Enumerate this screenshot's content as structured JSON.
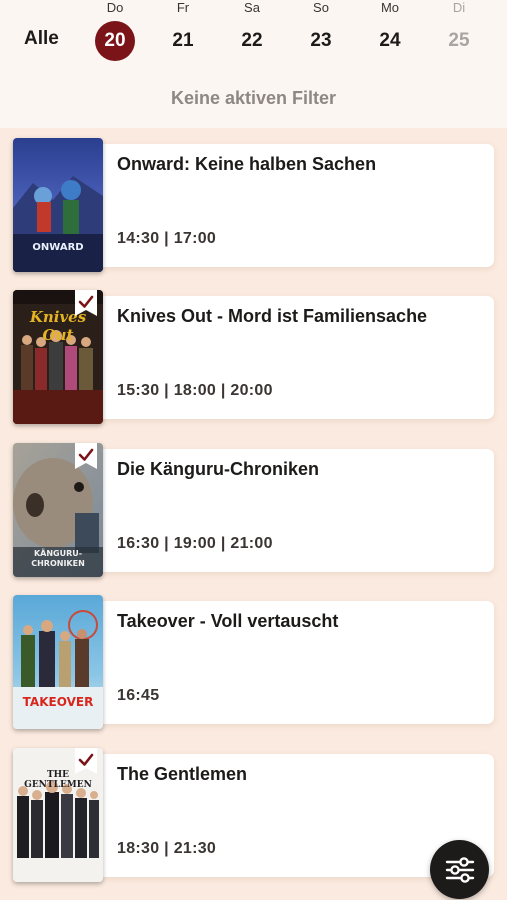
{
  "header": {
    "all_label": "Alle",
    "days": [
      {
        "name": "Do",
        "num": "20",
        "state": "selected"
      },
      {
        "name": "Fr",
        "num": "21",
        "state": "normal"
      },
      {
        "name": "Sa",
        "num": "22",
        "state": "normal"
      },
      {
        "name": "So",
        "num": "23",
        "state": "normal"
      },
      {
        "name": "Mo",
        "num": "24",
        "state": "normal"
      },
      {
        "name": "Di",
        "num": "25",
        "state": "disabled"
      }
    ],
    "filter_status": "Keine aktiven Filter"
  },
  "movies": [
    {
      "title": "Onward: Keine halben Sachen",
      "times": "14:30  |  17:00",
      "poster_text": "ONWARD",
      "checked": false
    },
    {
      "title": "Knives Out - Mord ist Familiensache",
      "times": "15:30  |  18:00  |  20:00",
      "poster_text": "Knives Out",
      "checked": true
    },
    {
      "title": "Die Känguru-Chroniken",
      "times": "16:30  |  19:00  |  21:00",
      "poster_text": "KÄNGURU-CHRONIKEN",
      "checked": true
    },
    {
      "title": "Takeover - Voll vertauscht",
      "times": "16:45",
      "poster_text": "TAKEOVER",
      "checked": false
    },
    {
      "title": "The Gentlemen",
      "times": "18:30  |  21:30",
      "poster_text": "THE GENTLEMEN",
      "checked": true
    }
  ],
  "colors": {
    "accent": "#7a1418",
    "background": "#fbeadf",
    "header_bg": "#fbf6f2",
    "text": "#1d1b1a"
  },
  "icons": {
    "filter": "sliders-icon",
    "watchlist": "checkmark-bookmark-icon"
  }
}
